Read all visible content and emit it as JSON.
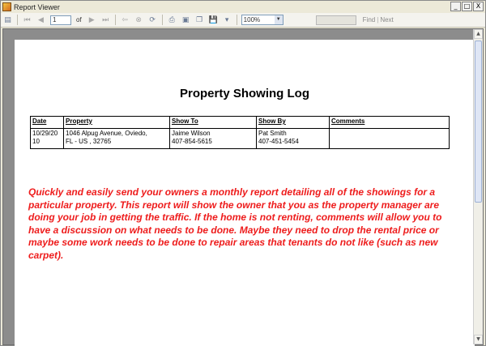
{
  "window": {
    "title": "Report Viewer",
    "minimize": "_",
    "maximize": "□",
    "close": "X"
  },
  "toolbar": {
    "page_number": "1",
    "of_label": "of",
    "zoom": "100%",
    "find_label": "Find",
    "separator": "|",
    "next_label": "Next"
  },
  "report": {
    "title": "Property Showing Log",
    "columns": [
      "Date",
      "Property",
      "Show To",
      "Show By",
      "Comments"
    ],
    "rows": [
      {
        "date_line1": "10/29/20",
        "date_line2": "10",
        "property_line1": "1046 Alpug Avenue, Oviedo,",
        "property_line2": "FL - US , 32765",
        "show_to_name": "Jaime Wilson",
        "show_to_phone": "407-854-5615",
        "show_by_name": "Pat Smith",
        "show_by_phone": "407-451-5454",
        "comments": ""
      }
    ],
    "description": "Quickly and easily send your owners a monthly report detailing all of the showings for a particular property. This report will show the owner that you as the property manager are doing your job in getting the traffic. If the home is not renting, comments will allow you to have a discussion on what needs to be done. Maybe they need to drop the rental price or maybe some work needs to be done to repair areas that tenants do not like (such as new carpet).",
    "description_color": "#ee1c1c"
  }
}
